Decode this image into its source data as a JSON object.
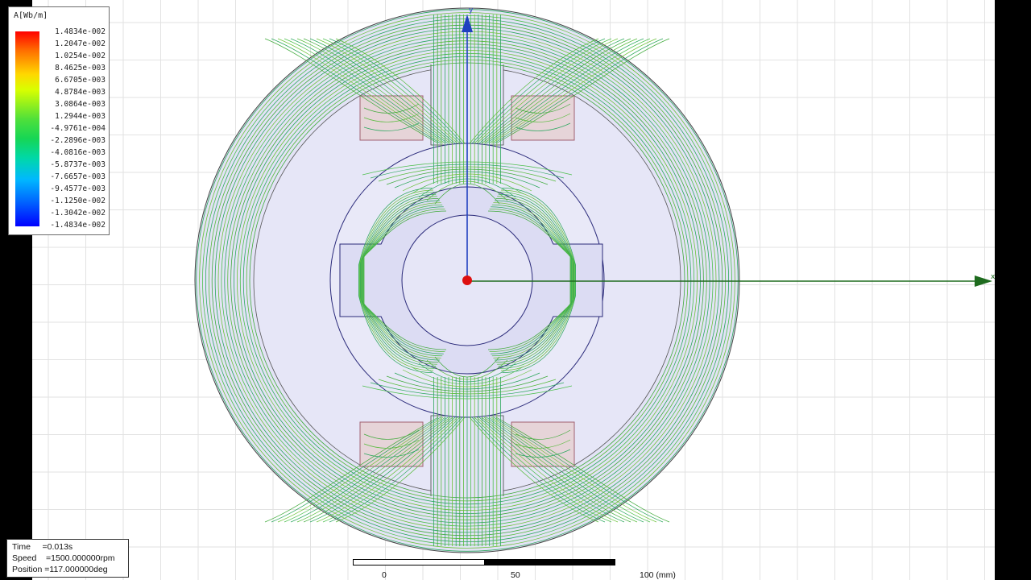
{
  "legend": {
    "title": "A[Wb/m]",
    "values": [
      "1.4834e-002",
      "1.2047e-002",
      "1.0254e-002",
      "8.4625e-003",
      "6.6705e-003",
      "4.8784e-003",
      "3.0864e-003",
      "1.2944e-003",
      "-4.9761e-004",
      "-2.2896e-003",
      "-4.0816e-003",
      "-5.8737e-003",
      "-7.6657e-003",
      "-9.4577e-003",
      "-1.1250e-002",
      "-1.3042e-002",
      "-1.4834e-002"
    ]
  },
  "status": {
    "time": "Time     =0.013s",
    "speed": "Speed    =1500.000000rpm",
    "position": "Position =117.000000deg"
  },
  "scale": {
    "label_0": "0",
    "label_50": "50",
    "label_100": "100 (mm)"
  },
  "axes": {
    "x_label": "x",
    "y_label": "y"
  },
  "colors": {
    "flux_line": "#3fb23f",
    "x_axis": "#1e6b1e",
    "y_axis": "#2040c0",
    "stator_fill": "#e3e3f6",
    "coil_fill": "#e6d4d8",
    "coil_stroke": "#a06070",
    "origin": "#dd1010"
  }
}
